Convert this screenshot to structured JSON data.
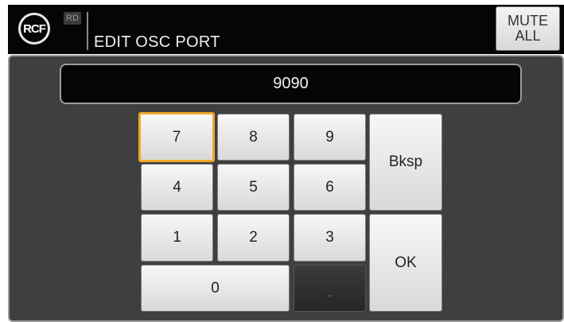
{
  "header": {
    "logo_text": "RCF",
    "model_badge": "RD",
    "title": "EDIT OSC PORT",
    "mute_line1": "MUTE",
    "mute_line2": "ALL"
  },
  "display": {
    "value": "9090"
  },
  "keypad": {
    "k7": "7",
    "k8": "8",
    "k9": "9",
    "bksp": "Bksp",
    "k4": "4",
    "k5": "5",
    "k6": "6",
    "k1": "1",
    "k2": "2",
    "k3": "3",
    "ok": "OK",
    "k0": "0",
    "dot": ".",
    "focused_key": "7",
    "focus_color": "#f0a92a"
  }
}
